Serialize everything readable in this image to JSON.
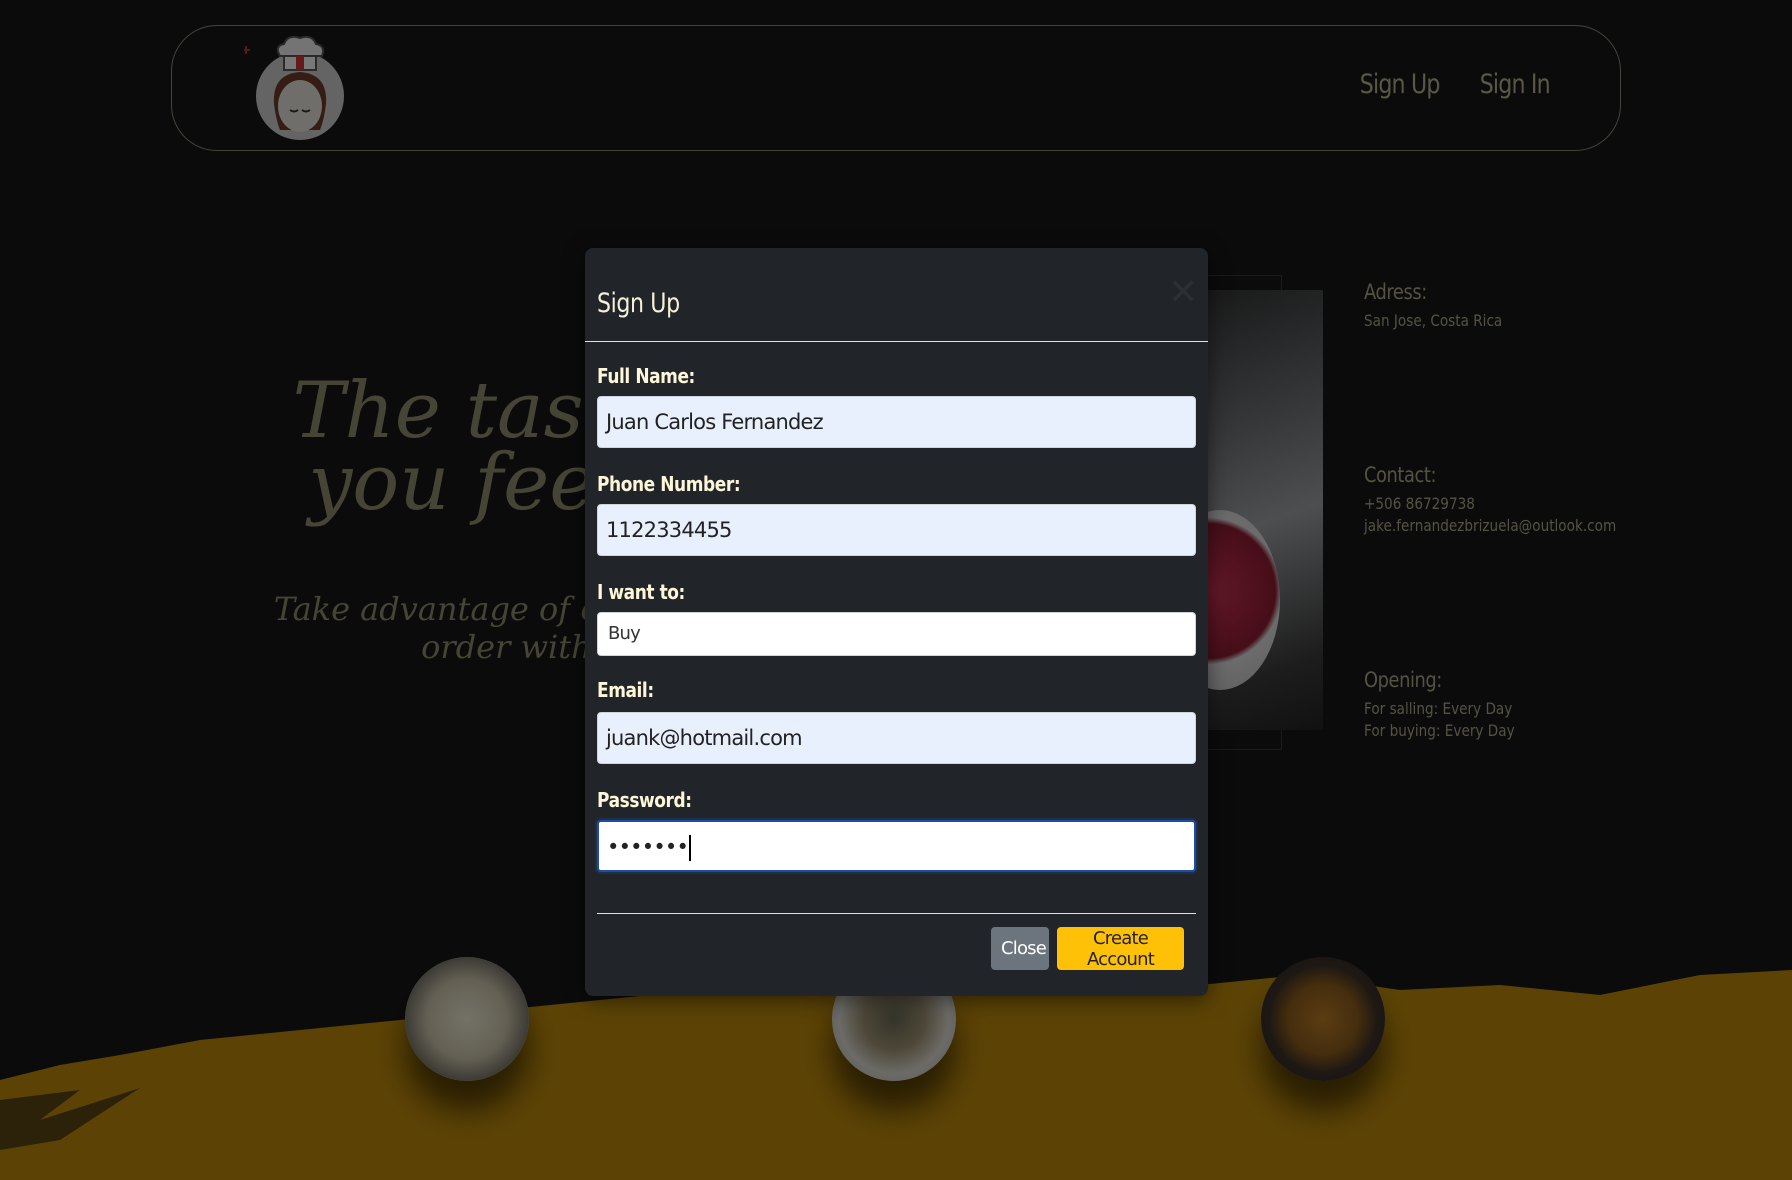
{
  "nav": {
    "logo_icon": "chef-logo-icon",
    "links": [
      "Sign Up",
      "Sign In"
    ]
  },
  "hero": {
    "title_line1": "The taste th",
    "title_line2": "you feel Au",
    "subtitle_line1": "Take advantage of our applicati",
    "subtitle_line2": "order with us"
  },
  "info": {
    "address_heading": "Adress:",
    "address": "San Jose, Costa Rica",
    "contact_heading": "Contact:",
    "phone": "+506 86729738",
    "email": "jake.fernandezbrizuela@outlook.com",
    "opening_heading": "Opening:",
    "selling": "For salling: Every Day",
    "buying": "For buying: Every Day"
  },
  "modal": {
    "title": "Sign Up",
    "close_icon": "close-icon",
    "fields": {
      "full_name_label": "Full Name:",
      "full_name_value": "Juan Carlos Fernandez",
      "phone_label": "Phone Number:",
      "phone_value": "1122334455",
      "want_label": "I want to:",
      "want_value": "Buy",
      "email_label": "Email:",
      "email_value": "juank@hotmail.com",
      "password_label": "Password:",
      "password_value": "•••••••"
    },
    "buttons": {
      "close": "Close",
      "create": "Create Account"
    }
  },
  "colors": {
    "background": "#171717",
    "accent": "#ffc107",
    "brush": "#b8860b",
    "text_muted": "#a8a586"
  }
}
